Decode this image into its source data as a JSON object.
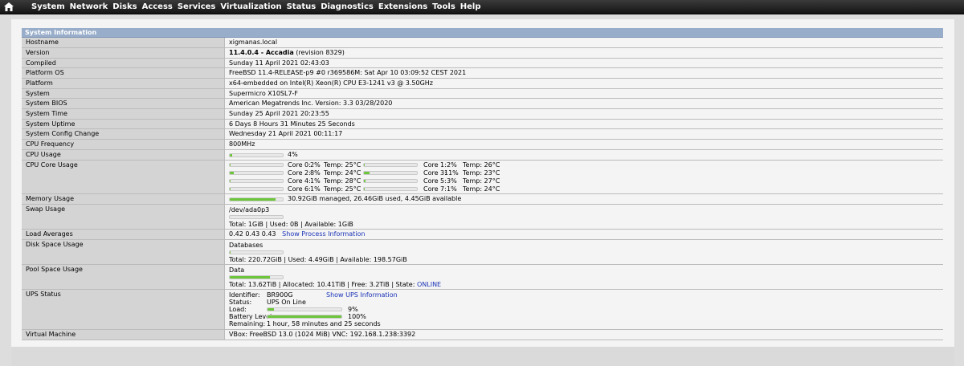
{
  "nav": [
    "System",
    "Network",
    "Disks",
    "Access",
    "Services",
    "Virtualization",
    "Status",
    "Diagnostics",
    "Extensions",
    "Tools",
    "Help"
  ],
  "section_title": "System Information",
  "hostname": {
    "label": "Hostname",
    "value": "xigmanas.local"
  },
  "version": {
    "label": "Version",
    "bold": "11.4.0.4 - Accadia",
    "rest": " (revision 8329)"
  },
  "compiled": {
    "label": "Compiled",
    "value": "Sunday 11 April 2021 02:43:03"
  },
  "platform_os": {
    "label": "Platform OS",
    "value": "FreeBSD 11.4-RELEASE-p9 #0 r369586M: Sat Apr 10 03:09:52 CEST 2021"
  },
  "platform": {
    "label": "Platform",
    "value": "x64-embedded on Intel(R) Xeon(R) CPU E3-1241 v3 @ 3.50GHz"
  },
  "system": {
    "label": "System",
    "value": "Supermicro X10SL7-F"
  },
  "system_bios": {
    "label": "System BIOS",
    "value": "American Megatrends Inc. Version: 3.3 03/28/2020"
  },
  "system_time": {
    "label": "System Time",
    "value": "Sunday 25 April 2021 20:23:55"
  },
  "system_uptime": {
    "label": "System Uptime",
    "value": "6 Days 8 Hours 31 Minutes 25 Seconds"
  },
  "config_change": {
    "label": "System Config Change",
    "value": "Wednesday 21 April 2021 00:11:17"
  },
  "cpu_freq": {
    "label": "CPU Frequency",
    "value": "800MHz"
  },
  "cpu_usage": {
    "label": "CPU Usage",
    "text": "4%",
    "percent": 4
  },
  "cpu_core": {
    "label": "CPU Core Usage",
    "cores": [
      {
        "name": "Core 0:",
        "usage": "2%",
        "temp": "Temp:  25°C",
        "percent": 2
      },
      {
        "name": "Core 1:",
        "usage": "2%",
        "temp": "Temp:  26°C",
        "percent": 2
      },
      {
        "name": "Core 2:",
        "usage": "8%",
        "temp": "Temp:  24°C",
        "percent": 8
      },
      {
        "name": "Core 3:",
        "usage": "11%",
        "temp": "Temp:  23°C",
        "percent": 11
      },
      {
        "name": "Core 4:",
        "usage": "1%",
        "temp": "Temp:  28°C",
        "percent": 1
      },
      {
        "name": "Core 5:",
        "usage": "3%",
        "temp": "Temp:  27°C",
        "percent": 3
      },
      {
        "name": "Core 6:",
        "usage": "1%",
        "temp": "Temp:  25°C",
        "percent": 1
      },
      {
        "name": "Core 7:",
        "usage": "1%",
        "temp": "Temp:  24°C",
        "percent": 1
      }
    ]
  },
  "memory": {
    "label": "Memory Usage",
    "text": "30.92GiB managed, 26.46GiB used, 4.45GiB available",
    "percent": 86
  },
  "swap": {
    "label": "Swap Usage",
    "device": "/dev/ada0p3",
    "summary": "Total: 1GiB | Used: 0B | Available: 1GiB",
    "percent": 0
  },
  "load": {
    "label": "Load Averages",
    "value": "0.42 0.43 0.43",
    "link": "Show Process Information"
  },
  "disk": {
    "label": "Disk Space Usage",
    "name": "Databases",
    "summary": "Total: 220.72GiB | Used: 4.49GiB | Available: 198.57GiB",
    "percent": 2
  },
  "pool": {
    "label": "Pool Space Usage",
    "name": "Data",
    "summary_pre": "Total: 13.62TiB | Allocated: 10.41TiB | Free: 3.2TiB | State: ",
    "state": "ONLINE",
    "percent": 76
  },
  "ups": {
    "label": "UPS Status",
    "identifier_label": "Identifier:",
    "identifier": "BR900G",
    "link": "Show UPS Information",
    "status_label": "Status:",
    "status": "UPS On Line",
    "load_label": "Load:",
    "load": "9%",
    "load_percent": 9,
    "battery_label": "Battery Level:",
    "battery": "100%",
    "battery_percent": 100,
    "remaining_label": "Remaining:",
    "remaining": "1 hour, 58 minutes and 25 seconds"
  },
  "vm": {
    "label": "Virtual Machine",
    "value": "VBox: FreeBSD 13.0 (1024 MiB) VNC: 192.168.1.238:3392"
  }
}
